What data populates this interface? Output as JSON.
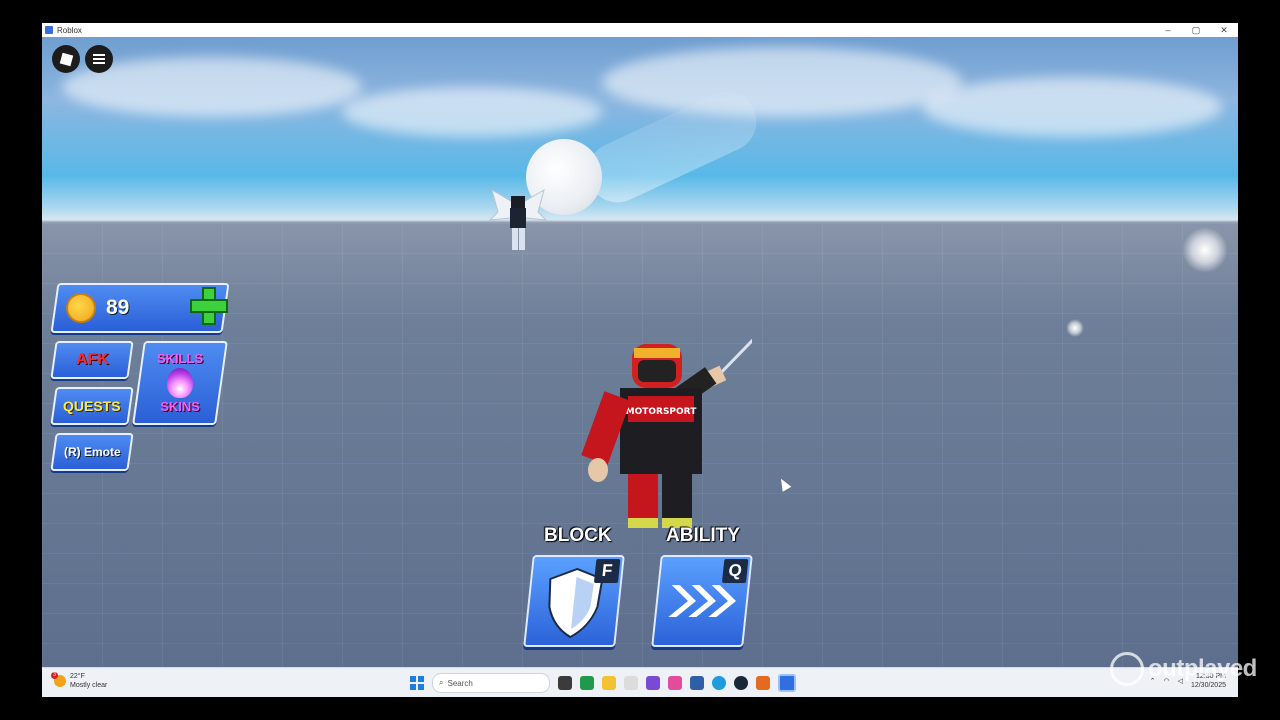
{
  "window": {
    "title": "Roblox",
    "controls": {
      "minimize": "–",
      "maximize": "▢",
      "close": "✕"
    }
  },
  "hud": {
    "coins": "89",
    "afk_label": "AFK",
    "quests_label": "QUESTS",
    "emote_label": "(R) Emote",
    "skills_label": "SKILLS",
    "skins_label": "SKINS"
  },
  "abilities": {
    "block": {
      "label": "BLOCK",
      "key": "F",
      "icon": "shield-icon"
    },
    "ability": {
      "label": "ABILITY",
      "key": "Q",
      "icon": "dash-arrows-icon"
    }
  },
  "player": {
    "shirt_text": "MOTORSPORT"
  },
  "taskbar": {
    "temperature": "22°F",
    "weather": "Mostly clear",
    "weather_badge": "3",
    "search_placeholder": "Search",
    "time": "12:30 PM",
    "date": "12/30/2025"
  },
  "watermark": "outplayed",
  "colors": {
    "hud_blue": "#2a5fd6",
    "afk_red": "#ff2a2a",
    "quests_yellow": "#ffe94a",
    "skills_pink": "#ff58ff",
    "plus_green": "#3ed13e"
  }
}
